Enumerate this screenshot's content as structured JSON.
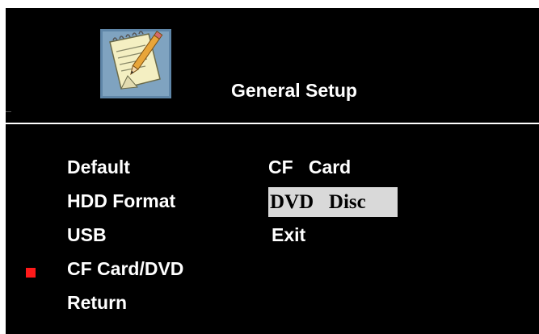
{
  "header": {
    "title": "General Setup",
    "logo_icon": "notepad-pencil-icon"
  },
  "menu": {
    "items": [
      {
        "label": "Default"
      },
      {
        "label": "HDD Format"
      },
      {
        "label": "USB"
      },
      {
        "label": "CF Card/DVD",
        "selected": true
      },
      {
        "label": "Return"
      }
    ]
  },
  "options": {
    "items": [
      {
        "label": "CF   Card"
      },
      {
        "label": "DVD   Disc",
        "highlighted": true
      },
      {
        "label": "Exit"
      }
    ]
  },
  "colors": {
    "background": "#000000",
    "text": "#ffffff",
    "marker": "#ff1a1a",
    "highlight_bg": "#d9d9d9"
  }
}
